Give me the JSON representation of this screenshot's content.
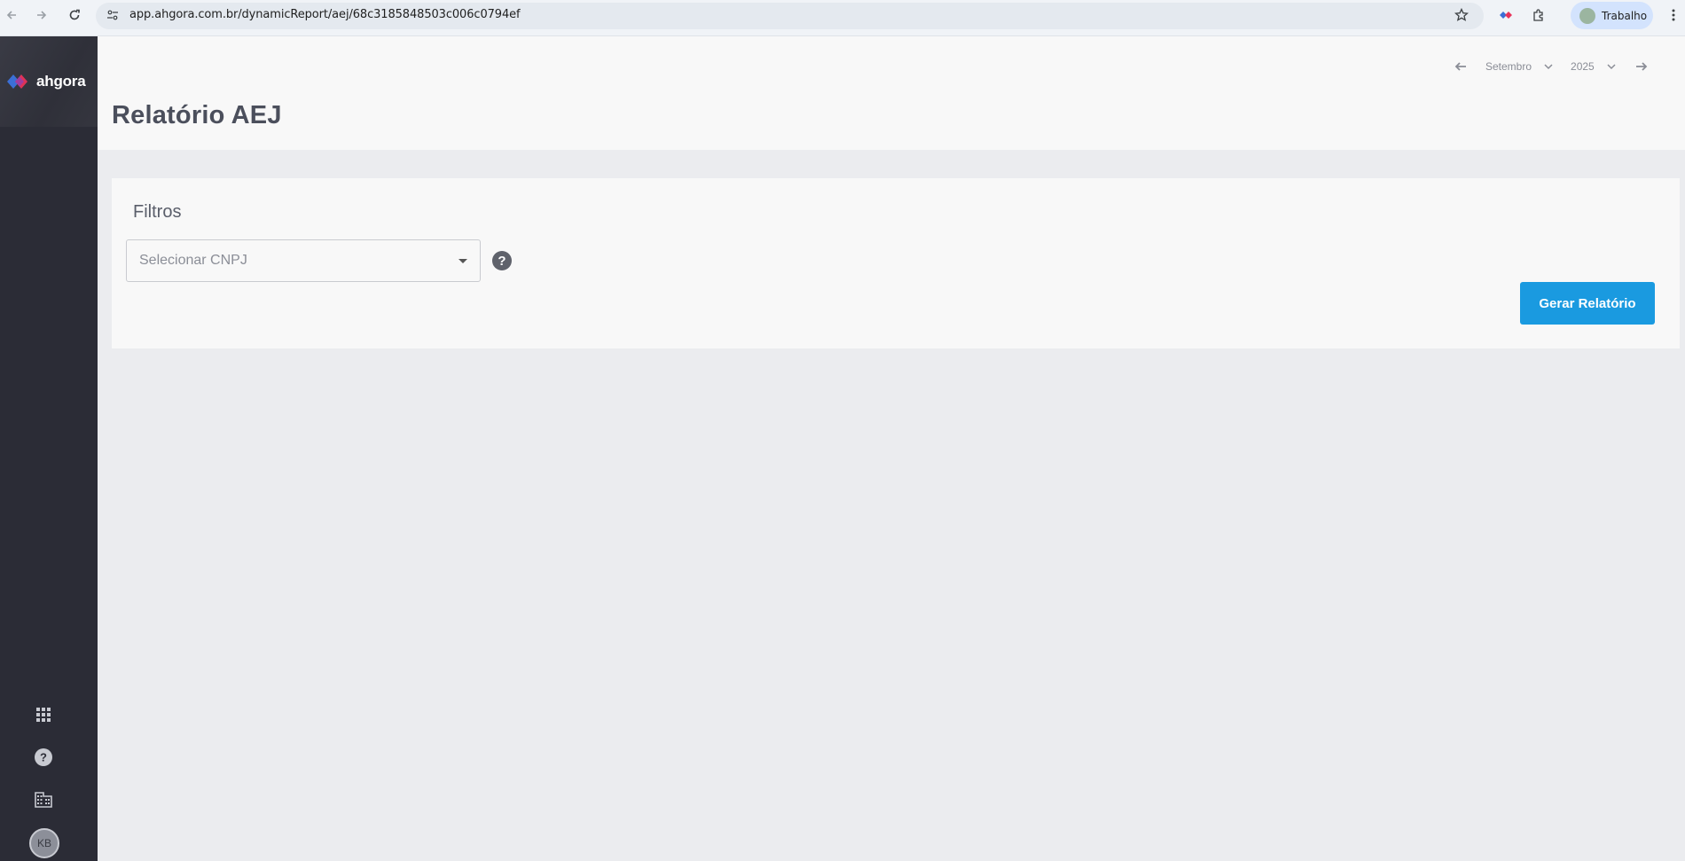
{
  "browser": {
    "url": "app.ahgora.com.br/dynamicReport/aej/68c3185848503c006c0794ef",
    "profile_label": "Trabalho"
  },
  "sidebar": {
    "brand": "ahgora",
    "user_initials": "KB"
  },
  "header": {
    "title": "Relatório AEJ",
    "month": "Setembro",
    "year": "2025"
  },
  "filters": {
    "title": "Filtros",
    "cnpj_placeholder": "Selecionar CNPJ",
    "help": "?",
    "generate_label": "Gerar Relatório"
  },
  "colors": {
    "accent": "#1a9ae0",
    "sidebar": "#2b2c36",
    "brand_logo_blue": "#3b6fd6",
    "brand_logo_red": "#e8335a"
  }
}
